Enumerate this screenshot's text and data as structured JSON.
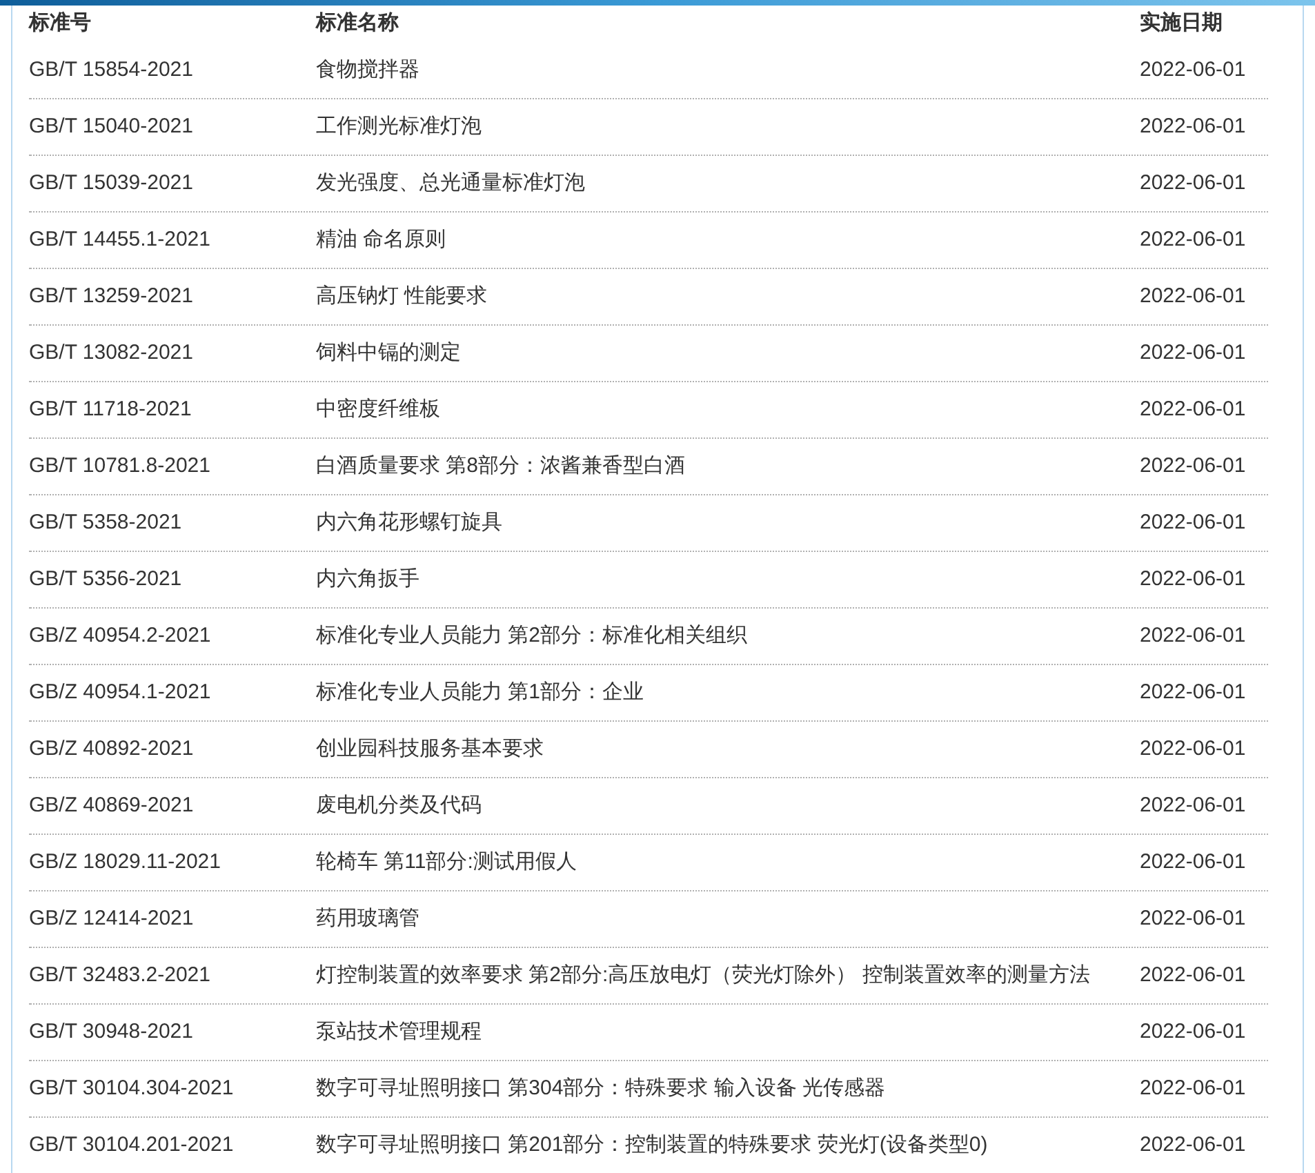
{
  "table": {
    "columns": [
      "标准号",
      "标准名称",
      "实施日期"
    ],
    "rows": [
      [
        "GB/T 15854-2021",
        "食物搅拌器",
        "2022-06-01"
      ],
      [
        "GB/T 15040-2021",
        "工作测光标准灯泡",
        "2022-06-01"
      ],
      [
        "GB/T 15039-2021",
        "发光强度、总光通量标准灯泡",
        "2022-06-01"
      ],
      [
        "GB/T 14455.1-2021",
        "精油 命名原则",
        "2022-06-01"
      ],
      [
        "GB/T 13259-2021",
        "高压钠灯 性能要求",
        "2022-06-01"
      ],
      [
        "GB/T 13082-2021",
        "饲料中镉的测定",
        "2022-06-01"
      ],
      [
        "GB/T 11718-2021",
        "中密度纤维板",
        "2022-06-01"
      ],
      [
        "GB/T 10781.8-2021",
        "白酒质量要求 第8部分：浓酱兼香型白酒",
        "2022-06-01"
      ],
      [
        "GB/T 5358-2021",
        "内六角花形螺钉旋具",
        "2022-06-01"
      ],
      [
        "GB/T 5356-2021",
        "内六角扳手",
        "2022-06-01"
      ],
      [
        "GB/Z 40954.2-2021",
        "标准化专业人员能力 第2部分：标准化相关组织",
        "2022-06-01"
      ],
      [
        "GB/Z 40954.1-2021",
        "标准化专业人员能力 第1部分：企业",
        "2022-06-01"
      ],
      [
        "GB/Z 40892-2021",
        "创业园科技服务基本要求",
        "2022-06-01"
      ],
      [
        "GB/Z 40869-2021",
        "废电机分类及代码",
        "2022-06-01"
      ],
      [
        "GB/Z 18029.11-2021",
        "轮椅车 第11部分:测试用假人",
        "2022-06-01"
      ],
      [
        "GB/Z 12414-2021",
        "药用玻璃管",
        "2022-06-01"
      ],
      [
        "GB/T 32483.2-2021",
        "灯控制装置的效率要求 第2部分:高压放电灯（荧光灯除外） 控制装置效率的测量方法",
        "2022-06-01"
      ],
      [
        "GB/T 30948-2021",
        "泵站技术管理规程",
        "2022-06-01"
      ],
      [
        "GB/T 30104.304-2021",
        "数字可寻址照明接口 第304部分：特殊要求 输入设备 光传感器",
        "2022-06-01"
      ],
      [
        "GB/T 30104.201-2021",
        "数字可寻址照明接口 第201部分：控制装置的特殊要求 荧光灯(设备类型0)",
        "2022-06-01"
      ]
    ]
  }
}
